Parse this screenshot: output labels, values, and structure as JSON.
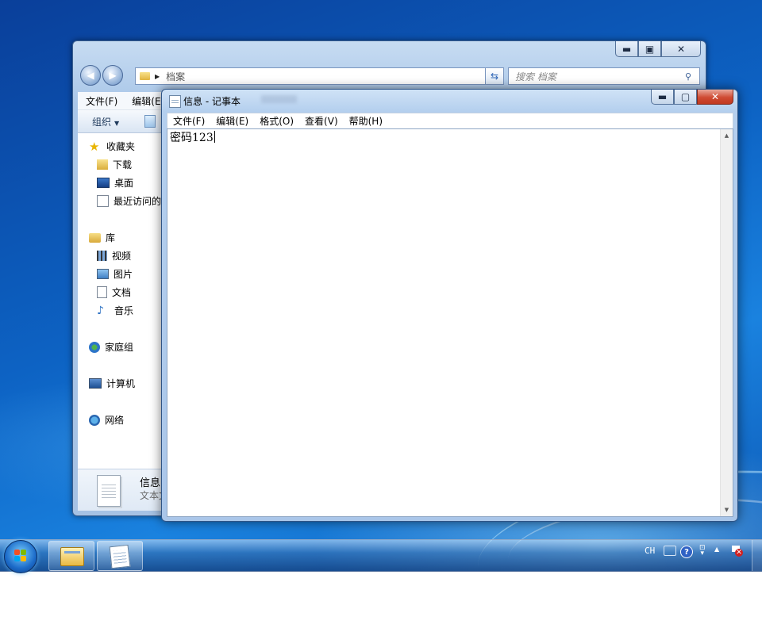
{
  "explorer": {
    "caption": {
      "minimize": "▬",
      "maximize": "▣",
      "close": "✕"
    },
    "address": {
      "path": "档案"
    },
    "search": {
      "placeholder": "搜索 档案"
    },
    "menu": {
      "file": "文件(F)",
      "edit": "编辑(E)"
    },
    "toolbar": {
      "organize": "组织"
    },
    "nav": {
      "favorites": {
        "label": "收藏夹",
        "items": [
          "下载",
          "桌面",
          "最近访问的"
        ]
      },
      "libraries": {
        "label": "库",
        "items": [
          "视频",
          "图片",
          "文档",
          "音乐"
        ]
      },
      "homegroup": "家庭组",
      "computer": "计算机",
      "network": "网络"
    },
    "details": {
      "name": "信息",
      "type": "文本文"
    }
  },
  "notepad": {
    "title": "信息 - 记事本",
    "caption": {
      "minimize": "▬",
      "maximize": "▢",
      "close": "✕"
    },
    "menu": {
      "file": "文件(F)",
      "edit": "编辑(E)",
      "format": "格式(O)",
      "view": "查看(V)",
      "help": "帮助(H)"
    },
    "content": "密码123"
  },
  "taskbar": {
    "tray": {
      "input_method": "CH",
      "help": "?"
    }
  }
}
